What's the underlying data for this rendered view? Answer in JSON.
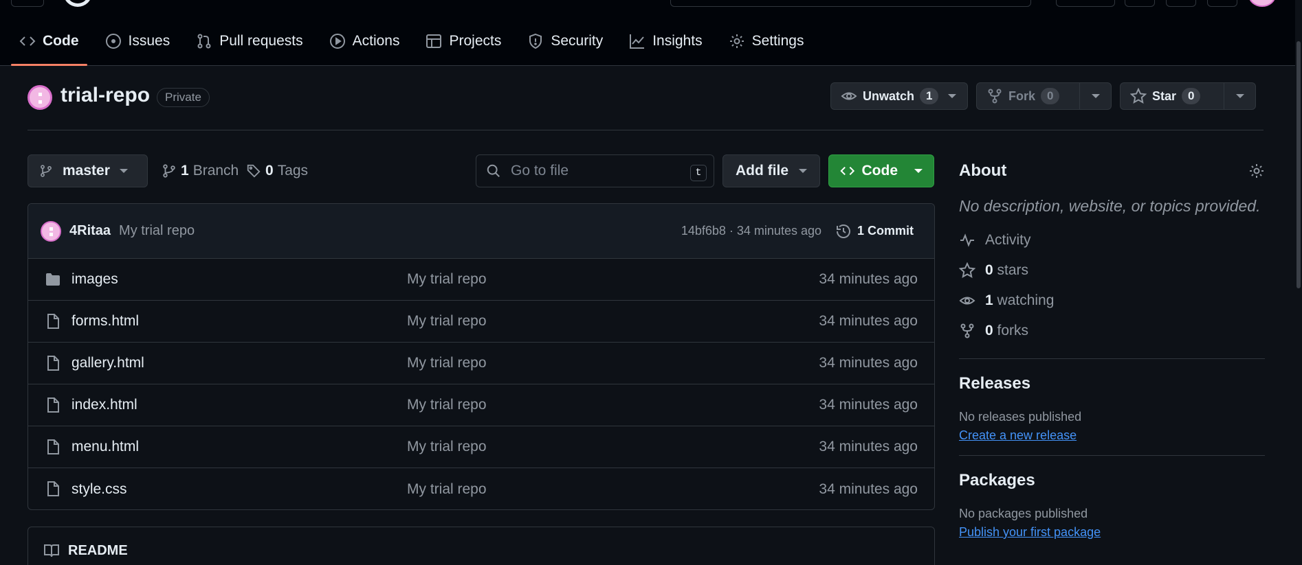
{
  "nav": {
    "tabs": [
      {
        "label": "Code",
        "icon": "code-icon"
      },
      {
        "label": "Issues",
        "icon": "issue-icon"
      },
      {
        "label": "Pull requests",
        "icon": "pull-request-icon"
      },
      {
        "label": "Actions",
        "icon": "play-icon"
      },
      {
        "label": "Projects",
        "icon": "table-icon"
      },
      {
        "label": "Security",
        "icon": "shield-icon"
      },
      {
        "label": "Insights",
        "icon": "graph-icon"
      },
      {
        "label": "Settings",
        "icon": "gear-icon"
      }
    ],
    "active": "Code"
  },
  "repo": {
    "name": "trial-repo",
    "visibility": "Private",
    "unwatch_label": "Unwatch",
    "watch_count": "1",
    "fork_label": "Fork",
    "fork_count": "0",
    "star_label": "Star",
    "star_count": "0"
  },
  "toolbar": {
    "branch": "master",
    "branch_count": "1",
    "branch_label": "Branch",
    "tag_count": "0",
    "tag_label": "Tags",
    "search_placeholder": "Go to file",
    "search_shortcut": "t",
    "add_file_label": "Add file",
    "code_label": "Code"
  },
  "commit": {
    "author": "4Ritaa",
    "message": "My trial repo",
    "meta": "14bf6b8 · 34 minutes ago",
    "count_label": "1 Commit"
  },
  "files": [
    {
      "name": "images",
      "type": "folder",
      "message": "My trial repo",
      "age": "34 minutes ago"
    },
    {
      "name": "forms.html",
      "type": "file",
      "message": "My trial repo",
      "age": "34 minutes ago"
    },
    {
      "name": "gallery.html",
      "type": "file",
      "message": "My trial repo",
      "age": "34 minutes ago"
    },
    {
      "name": "index.html",
      "type": "file",
      "message": "My trial repo",
      "age": "34 minutes ago"
    },
    {
      "name": "menu.html",
      "type": "file",
      "message": "My trial repo",
      "age": "34 minutes ago"
    },
    {
      "name": "style.css",
      "type": "file",
      "message": "My trial repo",
      "age": "34 minutes ago"
    }
  ],
  "readme": {
    "label": "README"
  },
  "about": {
    "title": "About",
    "description": "No description, website, or topics provided.",
    "activity": "Activity",
    "stars_count": "0",
    "stars_label": "stars",
    "watching_count": "1",
    "watching_label": "watching",
    "forks_count": "0",
    "forks_label": "forks"
  },
  "releases": {
    "title": "Releases",
    "text": "No releases published",
    "link": "Create a new release"
  },
  "packages": {
    "title": "Packages",
    "text": "No packages published",
    "link": "Publish your first package"
  },
  "colors": {
    "background": "#0d1117",
    "accent_green": "#238636",
    "active_tab_underline": "#f78166",
    "link": "#4493f8"
  }
}
